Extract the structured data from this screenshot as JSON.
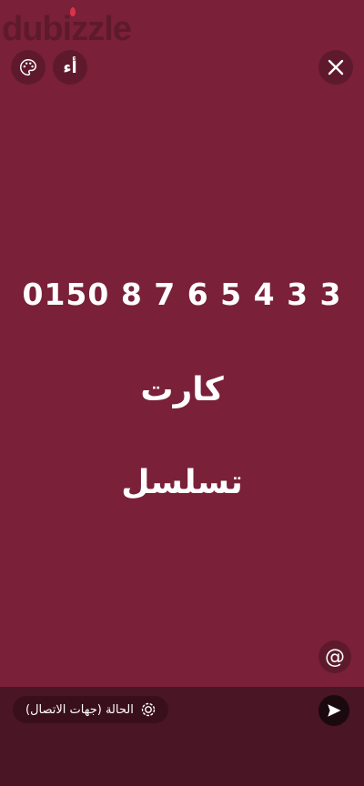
{
  "watermark": {
    "brand": "dubizzle"
  },
  "toolbar": {
    "palette_icon": "palette-icon",
    "font_label": "أء",
    "close_icon": "close-icon"
  },
  "status_text": {
    "number": "0150 8 7 6 5 4 3 3",
    "word1": "كارت",
    "word2": "تسلسل"
  },
  "mention": {
    "symbol": "@"
  },
  "composer": {
    "status_label": "الحالة (جهات الاتصال)",
    "status_icon": "status-ring-icon",
    "send_icon": "send-icon"
  },
  "colors": {
    "background": "#7a2039",
    "bottom_bar": "#4a1525"
  }
}
